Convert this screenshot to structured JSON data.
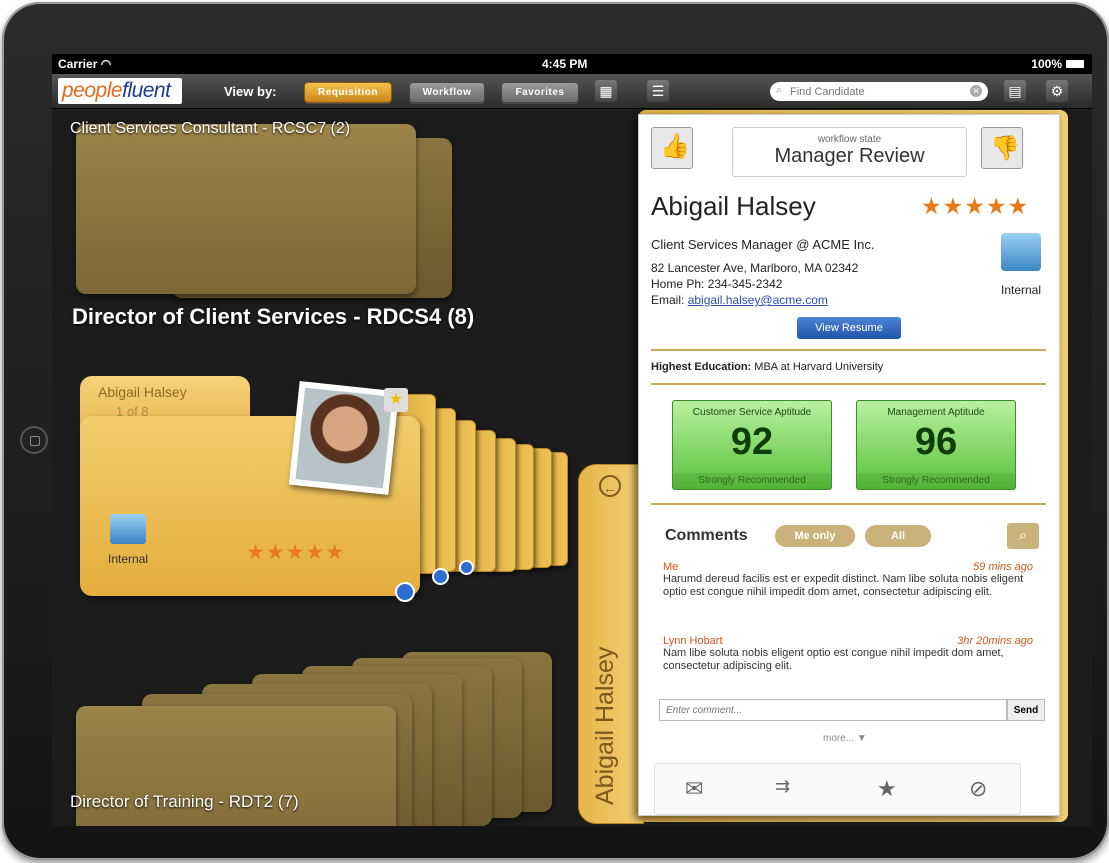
{
  "status": {
    "carrier": "Carrier",
    "time": "4:45 PM",
    "battery": "100%"
  },
  "toolbar": {
    "logo_a": "people",
    "logo_b": "fluent",
    "viewby_label": "View by:",
    "tabs": [
      "Requisition",
      "Workflow",
      "Favorites"
    ],
    "search_placeholder": "Find Candidate"
  },
  "groups": {
    "g1_title": "Client Services Consultant - RCSC7 (2)",
    "g2_title": "Director of Client Services - RDCS4 (8)",
    "g3_title": "Director of Training - RDT2 (7)"
  },
  "main_card": {
    "name": "Abigail Halsey",
    "position": "1 of 8",
    "badge_label": "Internal",
    "rating": "★★★★★"
  },
  "panel": {
    "workflow_label": "workflow state",
    "workflow_state": "Manager Review",
    "name": "Abigail Halsey",
    "rating": "★★★★★",
    "title": "Client Services Manager @ ACME Inc.",
    "address": "82 Lancester Ave, Marlboro, MA 02342",
    "phone": "Home Ph: 234-345-2342",
    "email_label": "Email:",
    "email": "abigail.halsey@acme.com",
    "badge_label": "Internal",
    "view_resume": "View Resume",
    "education_label": "Highest Education:",
    "education_value": "MBA at Harvard University",
    "aptitudes": [
      {
        "title": "Customer Service Aptitude",
        "score": "92",
        "rec": "Strongly Recommended"
      },
      {
        "title": "Management Aptitude",
        "score": "96",
        "rec": "Strongly Recommended"
      }
    ],
    "comments_label": "Comments",
    "filter_me": "Me only",
    "filter_all": "All",
    "comments": [
      {
        "author": "Me",
        "time": "59 mins ago",
        "text": "Harumd dereud facilis est er expedit distinct. Nam libe soluta nobis eligent optio est congue nihil impedit dom amet, consectetur adipiscing elit."
      },
      {
        "author": "Lynn Hobart",
        "time": "3hr 20mins ago",
        "text": "Nam libe soluta nobis eligent optio est congue nihil impedit dom amet, consectetur adipiscing elit."
      }
    ],
    "comment_placeholder": "Enter comment...",
    "send": "Send",
    "more": "more...",
    "spine_name": "Abigail Halsey"
  },
  "colors": {
    "accent": "#e87a1c",
    "folder": "#e8b74d",
    "green": "#59c23a"
  }
}
